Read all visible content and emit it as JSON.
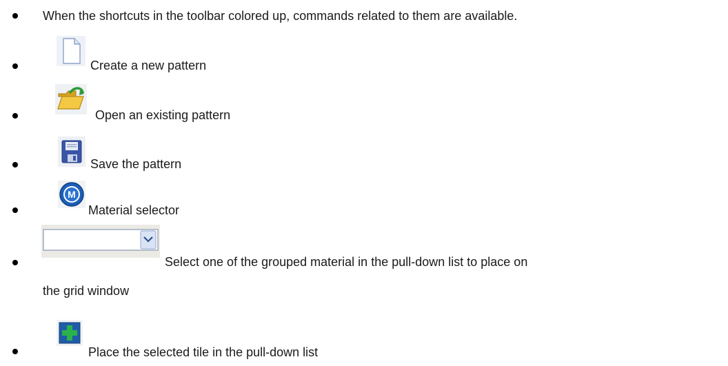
{
  "items": [
    {
      "text": "When the shortcuts in the toolbar colored up, commands related to them are available."
    },
    {
      "icon": "new-document-icon",
      "text": "Create a new pattern"
    },
    {
      "icon": "open-folder-icon",
      "text": "Open an existing pattern"
    },
    {
      "icon": "floppy-save-icon",
      "text": "Save the pattern"
    },
    {
      "icon": "material-m-icon",
      "text": "Material selector"
    },
    {
      "icon": "dropdown-select-icon",
      "text": "Select one of the grouped material in the pull-down list to place on",
      "text_cont": "the grid window"
    },
    {
      "icon": "place-tile-icon",
      "text": "Place the selected tile in the pull-down list"
    }
  ],
  "colors": {
    "text": "#1a1a1a",
    "bullet": "#000000",
    "folder": "#f0c040",
    "arrow": "#2e9a3a",
    "floppy": "#3a55a8",
    "m_circle": "#1c5fb8",
    "tile_bg": "#1f5ca8",
    "tile_plus": "#2bb24a"
  }
}
